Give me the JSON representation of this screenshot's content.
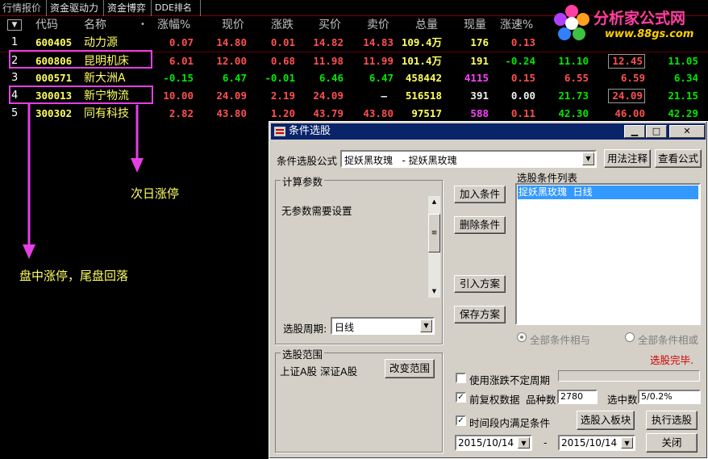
{
  "tabs": [
    "行情报价",
    "资金驱动力",
    "资金博弈",
    "DDE排名"
  ],
  "columns": [
    "代码",
    "名称",
    "涨幅%",
    "现价",
    "涨跌",
    "买价",
    "卖价",
    "总量",
    "现量",
    "涨速%"
  ],
  "name_dot": "•",
  "sort_marker": "▼",
  "rows": [
    {
      "idx": "1",
      "code": "600405",
      "name": "动力源",
      "chg_pct": "0.07",
      "price": "14.80",
      "chg": "0.01",
      "bid": "14.82",
      "ask": "14.83",
      "vol": "109.4万",
      "cur": "176",
      "speed": "0.13",
      "e1": "",
      "e2": "",
      "e3": ""
    },
    {
      "idx": "2",
      "code": "600806",
      "name": "昆明机床",
      "chg_pct": "6.01",
      "price": "12.00",
      "chg": "0.68",
      "bid": "11.98",
      "ask": "11.99",
      "vol": "101.4万",
      "cur": "191",
      "speed": "-0.24",
      "e1": "11.10",
      "e2": "12.45",
      "e3": "11.05"
    },
    {
      "idx": "3",
      "code": "000571",
      "name": "新大洲A",
      "chg_pct": "-0.15",
      "price": "6.47",
      "chg": "-0.01",
      "bid": "6.46",
      "ask": "6.47",
      "vol": "458442",
      "cur": "4115",
      "speed": "0.15",
      "e1": "6.55",
      "e2": "6.59",
      "e3": "6.34"
    },
    {
      "idx": "4",
      "code": "300013",
      "name": "新宁物流",
      "chg_pct": "10.00",
      "price": "24.09",
      "chg": "2.19",
      "bid": "24.09",
      "ask": "—",
      "vol": "516518",
      "cur": "391",
      "speed": "0.00",
      "e1": "21.73",
      "e2": "24.09",
      "e3": "21.15"
    },
    {
      "idx": "5",
      "code": "300302",
      "name": "同有科技",
      "chg_pct": "2.82",
      "price": "43.80",
      "chg": "1.20",
      "bid": "43.79",
      "ask": "43.80",
      "vol": "97517",
      "cur": "588",
      "speed": "0.11",
      "e1": "42.30",
      "e2": "46.00",
      "e3": "42.29"
    }
  ],
  "annotations": {
    "next_day": "次日涨停",
    "intraday": "盘中涨停，尾盘回落"
  },
  "logo": {
    "text": "分析家公式网",
    "url": "www.88gs.com"
  },
  "colors": {
    "up": "#ff5050",
    "down": "#00e800",
    "accent": "#e43fe4",
    "code": "#ffff60"
  },
  "dialog": {
    "title": "条件选股",
    "min": "▁",
    "max": "□",
    "close": "✕",
    "formula_label": "条件选股公式",
    "formula_value": "捉妖黑玫瑰   - 捉妖黑玫瑰",
    "usage_btn": "用法注释",
    "view_btn": "查看公式",
    "params_group": "计算参数",
    "params_text": "无参数需要设置",
    "add_btn": "加入条件",
    "del_btn": "删除条件",
    "load_btn": "引入方案",
    "save_btn": "保存方案",
    "list_label": "选股条件列表",
    "list_items": [
      "捉妖黑玫瑰  日线"
    ],
    "period_label": "选股周期:",
    "period_value": "日线",
    "radio_and": "全部条件相与",
    "radio_or": "全部条件相或",
    "status": "选股完毕.",
    "range_group": "选股范围",
    "range_text": "上证A股 深证A股",
    "change_range_btn": "改变范围",
    "chk1_label": "使用涨跌不定周期",
    "chk2_label": "前复权数据",
    "count_label": "品种数",
    "count_value": "2780",
    "selected_label": "选中数",
    "selected_value": "5/0.2%",
    "chk3_label": "时间段内满足条件",
    "to_block_btn": "选股入板块",
    "exec_btn": "执行选股",
    "date_from": "2015/10/14",
    "date_sep": "-",
    "date_to": "2015/10/14",
    "close_btn": "关闭",
    "check_mark": "✓"
  }
}
